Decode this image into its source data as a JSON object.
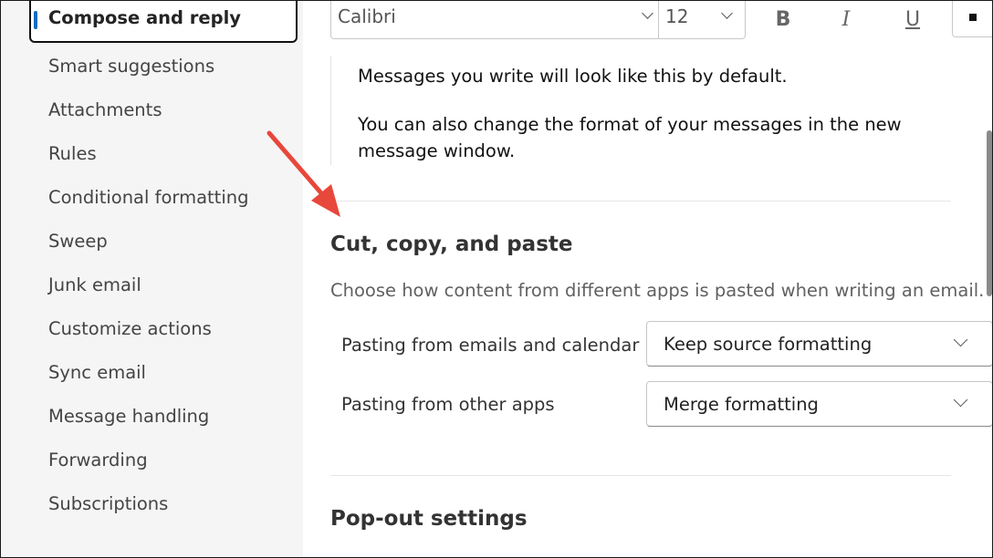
{
  "sidebar": {
    "selected": "Compose and reply",
    "items": [
      "Smart suggestions",
      "Attachments",
      "Rules",
      "Conditional formatting",
      "Sweep",
      "Junk email",
      "Customize actions",
      "Sync email",
      "Message handling",
      "Forwarding",
      "Subscriptions"
    ]
  },
  "toolbar": {
    "font_family": "Calibri",
    "font_size": "12",
    "bold_glyph": "B",
    "italic_glyph": "I",
    "underline_glyph": "U",
    "icons": [
      "chevron-down-icon",
      "bold-icon",
      "italic-icon",
      "underline-icon",
      "font-color-icon"
    ]
  },
  "preview": {
    "line1": "Messages you write will look like this by default.",
    "line2": "You can also change the format of your messages in the new message window."
  },
  "cut_copy_paste": {
    "title": "Cut, copy, and paste",
    "description": "Choose how content from different apps is pasted when writing an email.",
    "rows": [
      {
        "label": "Pasting from emails and calendar",
        "value": "Keep source formatting"
      },
      {
        "label": "Pasting from other apps",
        "value": "Merge formatting"
      }
    ]
  },
  "popout": {
    "title": "Pop-out settings"
  },
  "colors": {
    "accent": "#0f6cbd",
    "annotation_arrow": "#e8473b"
  }
}
